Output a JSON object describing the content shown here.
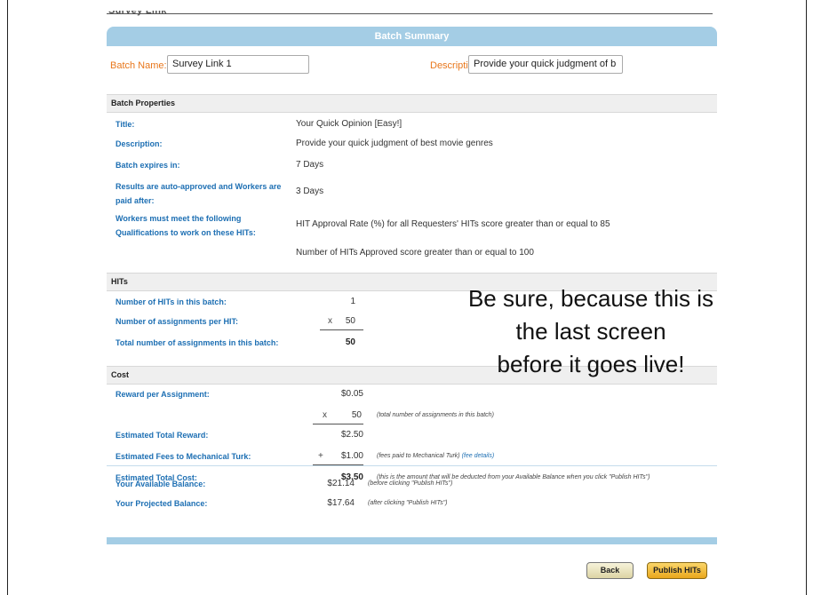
{
  "page": {
    "cropped_title": "Survey Link"
  },
  "summary": {
    "header": "Batch Summary",
    "batch_name_label": "Batch Name:",
    "batch_name_value": "Survey Link 1",
    "description_label": "Description:",
    "description_value": "Provide your quick judgment of b"
  },
  "properties": {
    "section_title": "Batch Properties",
    "rows": [
      {
        "label": "Title:",
        "value": "Your Quick Opinion [Easy!]"
      },
      {
        "label": "Description:",
        "value": "Provide your quick judgment of best movie genres"
      },
      {
        "label": "Batch expires in:",
        "value": "7 Days"
      },
      {
        "label_line1": "Results are auto-approved and Workers are",
        "label_line2": "paid after:",
        "value": "3 Days"
      },
      {
        "label_line1": "Workers must meet the following",
        "label_line2": "Qualifications to work on these HITs:",
        "value": "HIT Approval Rate (%) for all Requesters' HITs score greater than or equal to 85",
        "value2": "Number of HITs Approved score greater than or equal to 100"
      }
    ]
  },
  "hits": {
    "section_title": "HITs",
    "rows": [
      {
        "label": "Number of HITs in this batch:",
        "value": "1"
      },
      {
        "label": "Number of assignments per HIT:",
        "operator": "x",
        "value": "50"
      },
      {
        "label": "Total number of assignments in this batch:",
        "value": "50"
      }
    ]
  },
  "cost": {
    "section_title": "Cost",
    "reward_label": "Reward per Assignment:",
    "reward_value": "$0.05",
    "multiply_operator": "x",
    "multiply_value": "50",
    "multiply_note": "(total number of assignments in this batch)",
    "est_reward_label": "Estimated Total Reward:",
    "est_reward_value": "$2.50",
    "fees_label": "Estimated Fees to Mechanical Turk:",
    "fees_operator": "+",
    "fees_value": "$1.00",
    "fees_note": "(fees paid to Mechanical Turk)",
    "fees_link": "(fee details)",
    "total_label": "Estimated Total Cost:",
    "total_value": "$3.50",
    "total_note": "(this is the amount that will be deducted from your Available Balance when you click \"Publish HITs\")"
  },
  "balance": {
    "available_label": "Your Available Balance:",
    "available_value": "$21.14",
    "available_note": "(before clicking \"Publish HITs\")",
    "projected_label": "Your Projected Balance:",
    "projected_value": "$17.64",
    "projected_note": "(after clicking \"Publish HITs\")"
  },
  "overlay": {
    "line1": "Be sure, because this is",
    "line2": "the last screen",
    "line3": "before it goes live!"
  },
  "buttons": {
    "back_label": "Back",
    "publish_label": "Publish HITs"
  },
  "colors": {
    "accent_blue": "#a4cde5",
    "label_blue": "#1d6fb3",
    "label_orange": "#e8771c",
    "publish_button": "#f5c040"
  }
}
